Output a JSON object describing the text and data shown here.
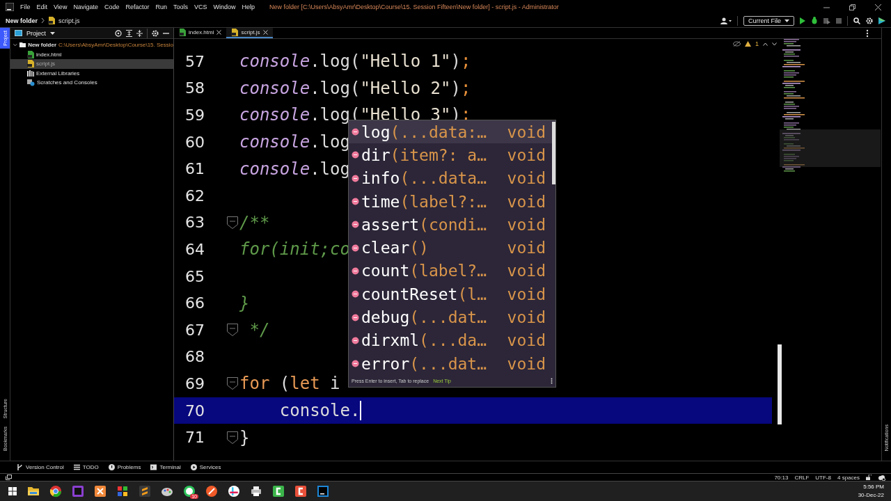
{
  "title_bar": {
    "menu": [
      "File",
      "Edit",
      "View",
      "Navigate",
      "Code",
      "Refactor",
      "Run",
      "Tools",
      "VCS",
      "Window",
      "Help"
    ],
    "title": "New folder [C:\\Users\\AbsyAmr\\Desktop\\Course\\15. Session Fifteen\\New folder] - script.js - Administrator"
  },
  "breadcrumb": [
    "New folder",
    "script.js"
  ],
  "run_config": "Current File",
  "side_stripe": {
    "left": [
      {
        "label": "Project",
        "selected": true
      },
      {
        "label": "Structure",
        "selected": false
      },
      {
        "label": "Bookmarks",
        "selected": false
      }
    ],
    "right": [
      {
        "label": "Notifications",
        "selected": false
      }
    ]
  },
  "project_panel": {
    "title": "Project",
    "tree": [
      {
        "label": "New folder",
        "path": "C:\\Users\\AbsyAmr\\Desktop\\Course\\15. Sessio",
        "kind": "folder",
        "expanded": true,
        "selected": false,
        "children": [
          {
            "label": "index.html",
            "kind": "html",
            "selected": false
          },
          {
            "label": "script.js",
            "kind": "js",
            "selected": true
          }
        ]
      },
      {
        "label": "External Libraries",
        "kind": "lib",
        "selected": false
      },
      {
        "label": "Scratches and Consoles",
        "kind": "scratch",
        "selected": false
      }
    ]
  },
  "editor_tabs": [
    {
      "label": "index.html",
      "kind": "html",
      "selected": false
    },
    {
      "label": "script.js",
      "kind": "js",
      "selected": true
    }
  ],
  "inspections": {
    "warnings": "1"
  },
  "code": [
    {
      "number": "57",
      "fold": false,
      "selected": false,
      "tokens": [
        {
          "kind": "method",
          "text": "console"
        },
        {
          "kind": "plain",
          "text": ".log("
        },
        {
          "kind": "string",
          "text": "\"Hello 1\""
        },
        {
          "kind": "plain",
          "text": ")"
        },
        {
          "kind": "punct",
          "text": ";"
        }
      ]
    },
    {
      "number": "58",
      "fold": false,
      "selected": false,
      "tokens": [
        {
          "kind": "method",
          "text": "console"
        },
        {
          "kind": "plain",
          "text": ".log("
        },
        {
          "kind": "string",
          "text": "\"Hello 2\""
        },
        {
          "kind": "plain",
          "text": ")"
        },
        {
          "kind": "punct",
          "text": ";"
        }
      ]
    },
    {
      "number": "59",
      "fold": false,
      "selected": false,
      "tokens": [
        {
          "kind": "method",
          "text": "console"
        },
        {
          "kind": "plain",
          "text": ".log("
        },
        {
          "kind": "string",
          "text": "\"Hello 3\""
        },
        {
          "kind": "plain",
          "text": ")"
        },
        {
          "kind": "punct",
          "text": ";"
        }
      ]
    },
    {
      "number": "60",
      "fold": false,
      "selected": false,
      "tokens": [
        {
          "kind": "method",
          "text": "console"
        },
        {
          "kind": "plain",
          "text": ".log"
        }
      ]
    },
    {
      "number": "61",
      "fold": false,
      "selected": false,
      "tokens": [
        {
          "kind": "method",
          "text": "console"
        },
        {
          "kind": "plain",
          "text": ".log"
        }
      ]
    },
    {
      "number": "62",
      "fold": false,
      "selected": false
    },
    {
      "number": "63",
      "fold": true,
      "selected": false,
      "tokens": [
        {
          "kind": "comment",
          "text": "/**"
        }
      ]
    },
    {
      "number": "64",
      "fold": false,
      "selected": false,
      "tokens": [
        {
          "kind": "comment",
          "text": "for(init;co"
        }
      ]
    },
    {
      "number": "65",
      "fold": false,
      "selected": false
    },
    {
      "number": "66",
      "fold": false,
      "selected": false,
      "tokens": [
        {
          "kind": "comment",
          "text": "}"
        }
      ]
    },
    {
      "number": "67",
      "fold": true,
      "selected": false,
      "tokens": [
        {
          "kind": "comment",
          "text": " */"
        }
      ]
    },
    {
      "number": "68",
      "fold": false,
      "selected": false
    },
    {
      "number": "69",
      "fold": true,
      "selected": false,
      "tokens": [
        {
          "kind": "keyword",
          "text": "for"
        },
        {
          "kind": "plain",
          "text": " ("
        },
        {
          "kind": "keyword",
          "text": "let"
        },
        {
          "kind": "plain",
          "text": " i"
        }
      ]
    },
    {
      "number": "70",
      "fold": false,
      "selected": true,
      "tokens": [
        {
          "kind": "plain",
          "text": "    console."
        }
      ]
    },
    {
      "number": "71",
      "fold": true,
      "selected": false,
      "tokens": [
        {
          "kind": "plain",
          "text": "}"
        }
      ]
    }
  ],
  "completion": {
    "items": [
      {
        "name": "log",
        "params": "(...data:…",
        "type": "void",
        "selected": true
      },
      {
        "name": "dir",
        "params": "(item?: a…",
        "type": "void",
        "selected": false
      },
      {
        "name": "info",
        "params": "(...data…",
        "type": "void",
        "selected": false
      },
      {
        "name": "time",
        "params": "(label?:…",
        "type": "void",
        "selected": false
      },
      {
        "name": "assert",
        "params": "(condi…",
        "type": "void",
        "selected": false
      },
      {
        "name": "clear",
        "params": "()",
        "type": "void",
        "selected": false
      },
      {
        "name": "count",
        "params": "(label?…",
        "type": "void",
        "selected": false
      },
      {
        "name": "countReset",
        "params": "(l…",
        "type": "void",
        "selected": false
      },
      {
        "name": "debug",
        "params": "(...dat…",
        "type": "void",
        "selected": false
      },
      {
        "name": "dirxml",
        "params": "(...da…",
        "type": "void",
        "selected": false
      },
      {
        "name": "error",
        "params": "(...dat…",
        "type": "void",
        "selected": false
      }
    ],
    "hint": "Press Enter to insert, Tab to replace",
    "tip_link": "Next Tip"
  },
  "tool_tabs": [
    {
      "label": "Version Control",
      "kind": "vcs"
    },
    {
      "label": "TODO",
      "kind": "todo"
    },
    {
      "label": "Problems",
      "kind": "problems"
    },
    {
      "label": "Terminal",
      "kind": "terminal"
    },
    {
      "label": "Services",
      "kind": "services"
    }
  ],
  "status_bar": [
    "70:13",
    "CRLF",
    "UTF-8",
    "4 spaces"
  ],
  "taskbar": {
    "apps": [
      {
        "kind": "folder"
      },
      {
        "kind": "browser"
      },
      {
        "kind": "ps"
      },
      {
        "kind": "xampp"
      },
      {
        "kind": "tiles"
      },
      {
        "kind": "sublime"
      },
      {
        "kind": "paint"
      },
      {
        "kind": "chat",
        "badge": "10"
      },
      {
        "kind": "orange"
      },
      {
        "kind": "slack"
      },
      {
        "kind": "printer"
      },
      {
        "kind": "green"
      },
      {
        "kind": "red"
      },
      {
        "kind": "ws"
      }
    ],
    "time": "5:56 PM",
    "date": "30-Dec-22"
  }
}
